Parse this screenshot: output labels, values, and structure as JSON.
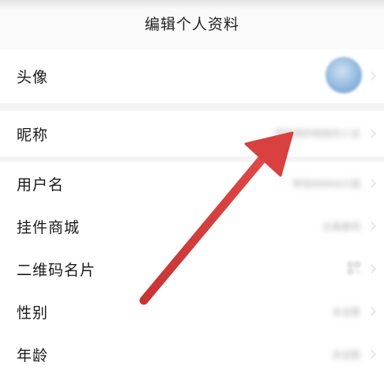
{
  "header": {
    "title": "编辑个人资料"
  },
  "rows": [
    {
      "label": "头像",
      "value": ""
    },
    {
      "label": "昵称",
      "value": "琴悦阁的桃桃的小宝"
    },
    {
      "label": "用户名",
      "value": "琴悦88868大猫"
    },
    {
      "label": "挂件商城",
      "value": "去看看吧"
    },
    {
      "label": "二维码名片",
      "value": ""
    },
    {
      "label": "性别",
      "value": "未设置"
    },
    {
      "label": "年龄",
      "value": "未设置"
    }
  ],
  "annotation": {
    "arrow_color": "#d94040"
  },
  "icons": {
    "chevron": "chevron-right-icon",
    "qr": "qr-code-icon"
  }
}
